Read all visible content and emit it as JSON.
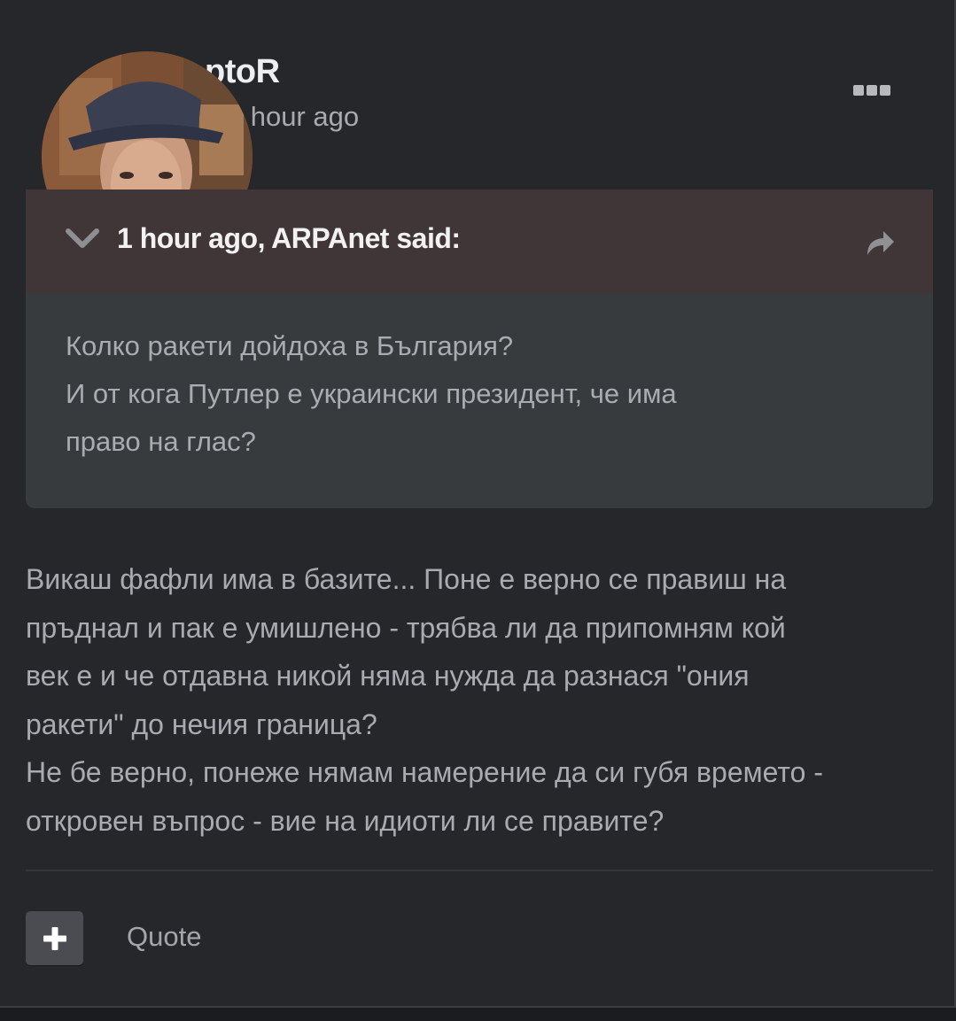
{
  "post": {
    "author_partial": "ptoR",
    "posted_partial": "d 1 hour ago",
    "menu_icon": "ellipsis-icon"
  },
  "quote": {
    "citation": "1 hour ago, ARPAnet said:",
    "lines": [
      "Колко ракети дойдоха в България?",
      "И от кога Путлер е украински президент,  че има",
      "право на глас?"
    ]
  },
  "reply": {
    "lines": [
      "Викаш фафли има в базите... Поне е верно се правиш на",
      "пръднал и пак е умишлено - трябва ли да припомням кой",
      "век е и че отдавна никой няма нужда да разнася \"ония",
      "ракети\" до нечия граница?",
      "Не бе верно, понеже нямам намерение да си губя времето -",
      "откровен въпрос - вие на идиоти ли се правите?"
    ]
  },
  "actions": {
    "plus_icon": "plus-icon",
    "quote_label": "Quote"
  },
  "colors": {
    "page_bg": "#26272b",
    "quote_header_bg": "#403637",
    "quote_body_bg": "#373b3e",
    "button_bg": "#4a4c52"
  }
}
